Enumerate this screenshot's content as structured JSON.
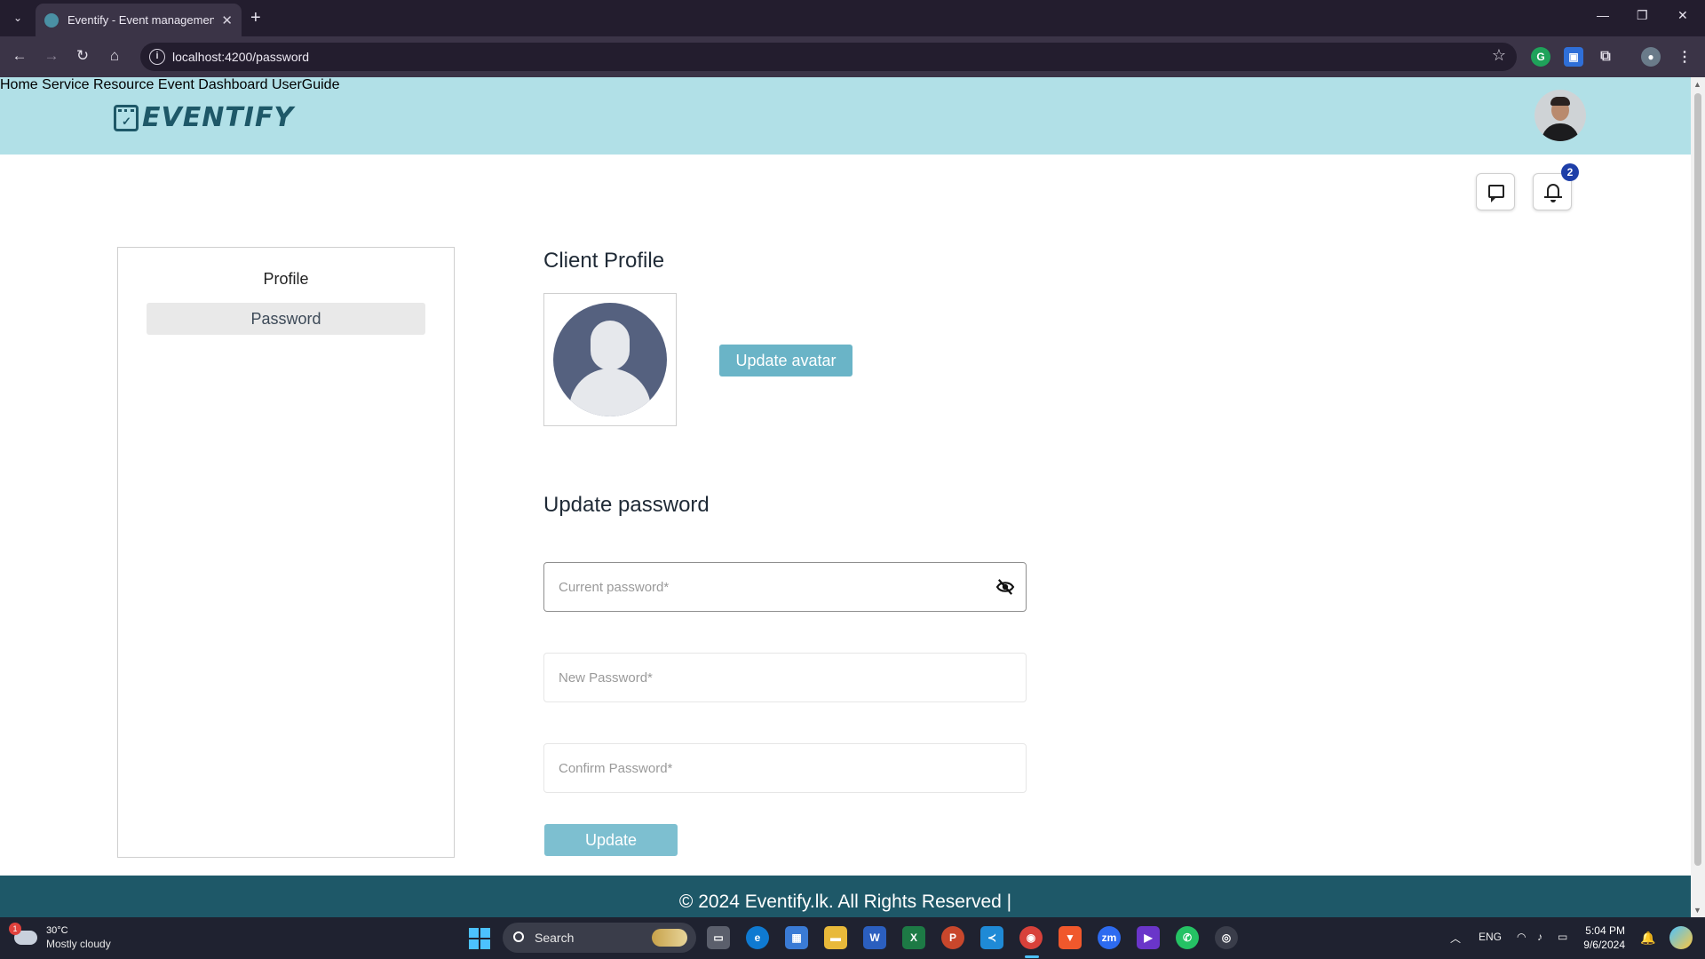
{
  "browser": {
    "tab_title": "Eventify - Event management s",
    "url": "localhost:4200/password"
  },
  "header": {
    "logo_text": "EVENTIFY",
    "nav": [
      "Home",
      "Service",
      "Resource",
      "Event",
      "Dashboard",
      "UserGuide"
    ],
    "notification_count": "2"
  },
  "sidebar": {
    "items": [
      "Profile",
      "Password"
    ],
    "active_index": 1
  },
  "profile": {
    "title": "Client Profile",
    "update_avatar_label": "Update avatar"
  },
  "password_form": {
    "title": "Update password",
    "current_placeholder": "Current password*",
    "new_placeholder": "New Password*",
    "confirm_placeholder": "Confirm Password*",
    "submit_label": "Update"
  },
  "footer": {
    "text": "© 2024 Eventify.lk. All Rights Reserved |"
  },
  "taskbar": {
    "weather_temp": "30°C",
    "weather_condition": "Mostly cloudy",
    "weather_alert_count": "1",
    "search_label": "Search",
    "language": "ENG",
    "time": "5:04 PM",
    "date": "9/6/2024"
  },
  "colors": {
    "header_bg": "#b1e0e7",
    "brand": "#1e5868",
    "accent_button": "#6ab4c7",
    "notification_badge": "#1e3fa8"
  }
}
